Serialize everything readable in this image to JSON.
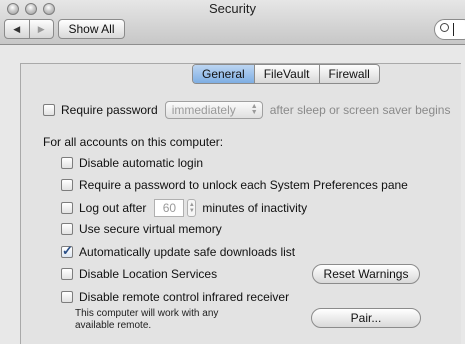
{
  "window": {
    "title": "Security"
  },
  "toolbar": {
    "back_symbol": "◀",
    "forward_symbol": "▶",
    "show_all_label": "Show All",
    "search_value": ""
  },
  "tabs": [
    {
      "label": "General",
      "active": true
    },
    {
      "label": "FileVault",
      "active": false
    },
    {
      "label": "Firewall",
      "active": false
    }
  ],
  "general": {
    "require_password": {
      "checked": false,
      "label": "Require password",
      "select_value": "immediately",
      "suffix": "after sleep or screen saver begins"
    },
    "section_heading": "For all accounts on this computer:",
    "options": {
      "disable_auto_login": {
        "checked": false,
        "label": "Disable automatic login"
      },
      "require_password_unlock": {
        "checked": false,
        "label": "Require a password to unlock each System Preferences pane"
      },
      "logout_after": {
        "checked": false,
        "label": "Log out after",
        "value": "60",
        "suffix": "minutes of inactivity"
      },
      "secure_vm": {
        "checked": false,
        "label": "Use secure virtual memory"
      },
      "auto_update_safe": {
        "checked": true,
        "label": "Automatically update safe downloads list"
      },
      "disable_location": {
        "checked": false,
        "label": "Disable Location Services"
      },
      "disable_ir": {
        "checked": false,
        "label": "Disable remote control infrared receiver"
      }
    },
    "ir_note": "This computer will work with any available remote.",
    "reset_warnings_label": "Reset Warnings",
    "pair_label": "Pair..."
  },
  "colors": {
    "active_tab": "#7eaee3",
    "checkmark": "#2a4f87"
  }
}
